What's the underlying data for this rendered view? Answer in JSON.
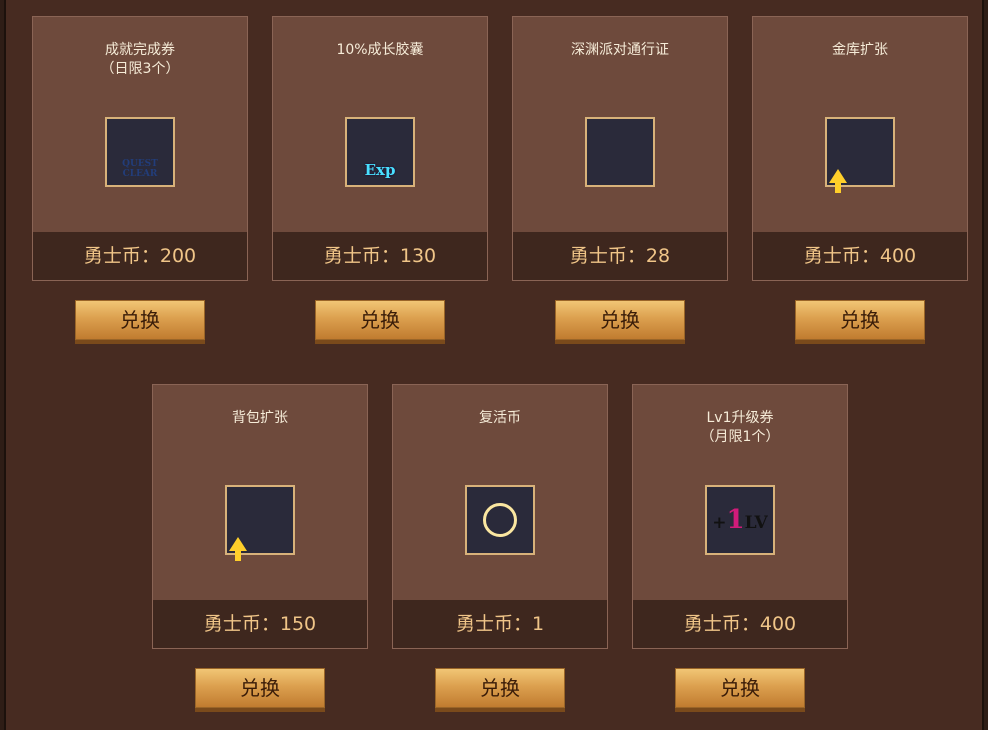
{
  "currency_label": "勇士币：",
  "exchange_label": "兑换",
  "items": [
    {
      "title_l1": "成就完成券",
      "title_l2": "（日限3个）",
      "icon": "quest-clear-ticket-icon",
      "price": "勇士币：200"
    },
    {
      "title_l1": "10%成长胶囊",
      "title_l2": "",
      "icon": "exp-capsule-icon",
      "price": "勇士币：130"
    },
    {
      "title_l1": "深渊派对通行证",
      "title_l2": "",
      "icon": "abyss-pass-icon",
      "price": "勇士币：28"
    },
    {
      "title_l1": "金库扩张",
      "title_l2": "",
      "icon": "vault-expand-icon",
      "price": "勇士币：400"
    },
    {
      "title_l1": "背包扩张",
      "title_l2": "",
      "icon": "bag-expand-icon",
      "price": "勇士币：150"
    },
    {
      "title_l1": "复活币",
      "title_l2": "",
      "icon": "revive-coin-icon",
      "price": "勇士币：1"
    },
    {
      "title_l1": "Lv1升级券",
      "title_l2": "（月限1个）",
      "icon": "lv1-upgrade-ticket-icon",
      "price": "勇士币：400"
    }
  ],
  "icon_text": {
    "quest": "QUEST CLEAR",
    "exp": "Exp",
    "lv_plus": "+",
    "lv_one": "1",
    "lv_suffix": "LV"
  },
  "colors": {
    "card_bg": "#6e4a3c",
    "price_bg": "#3e271e",
    "price_text": "#f0c588",
    "button_gold": "#dca04f"
  }
}
